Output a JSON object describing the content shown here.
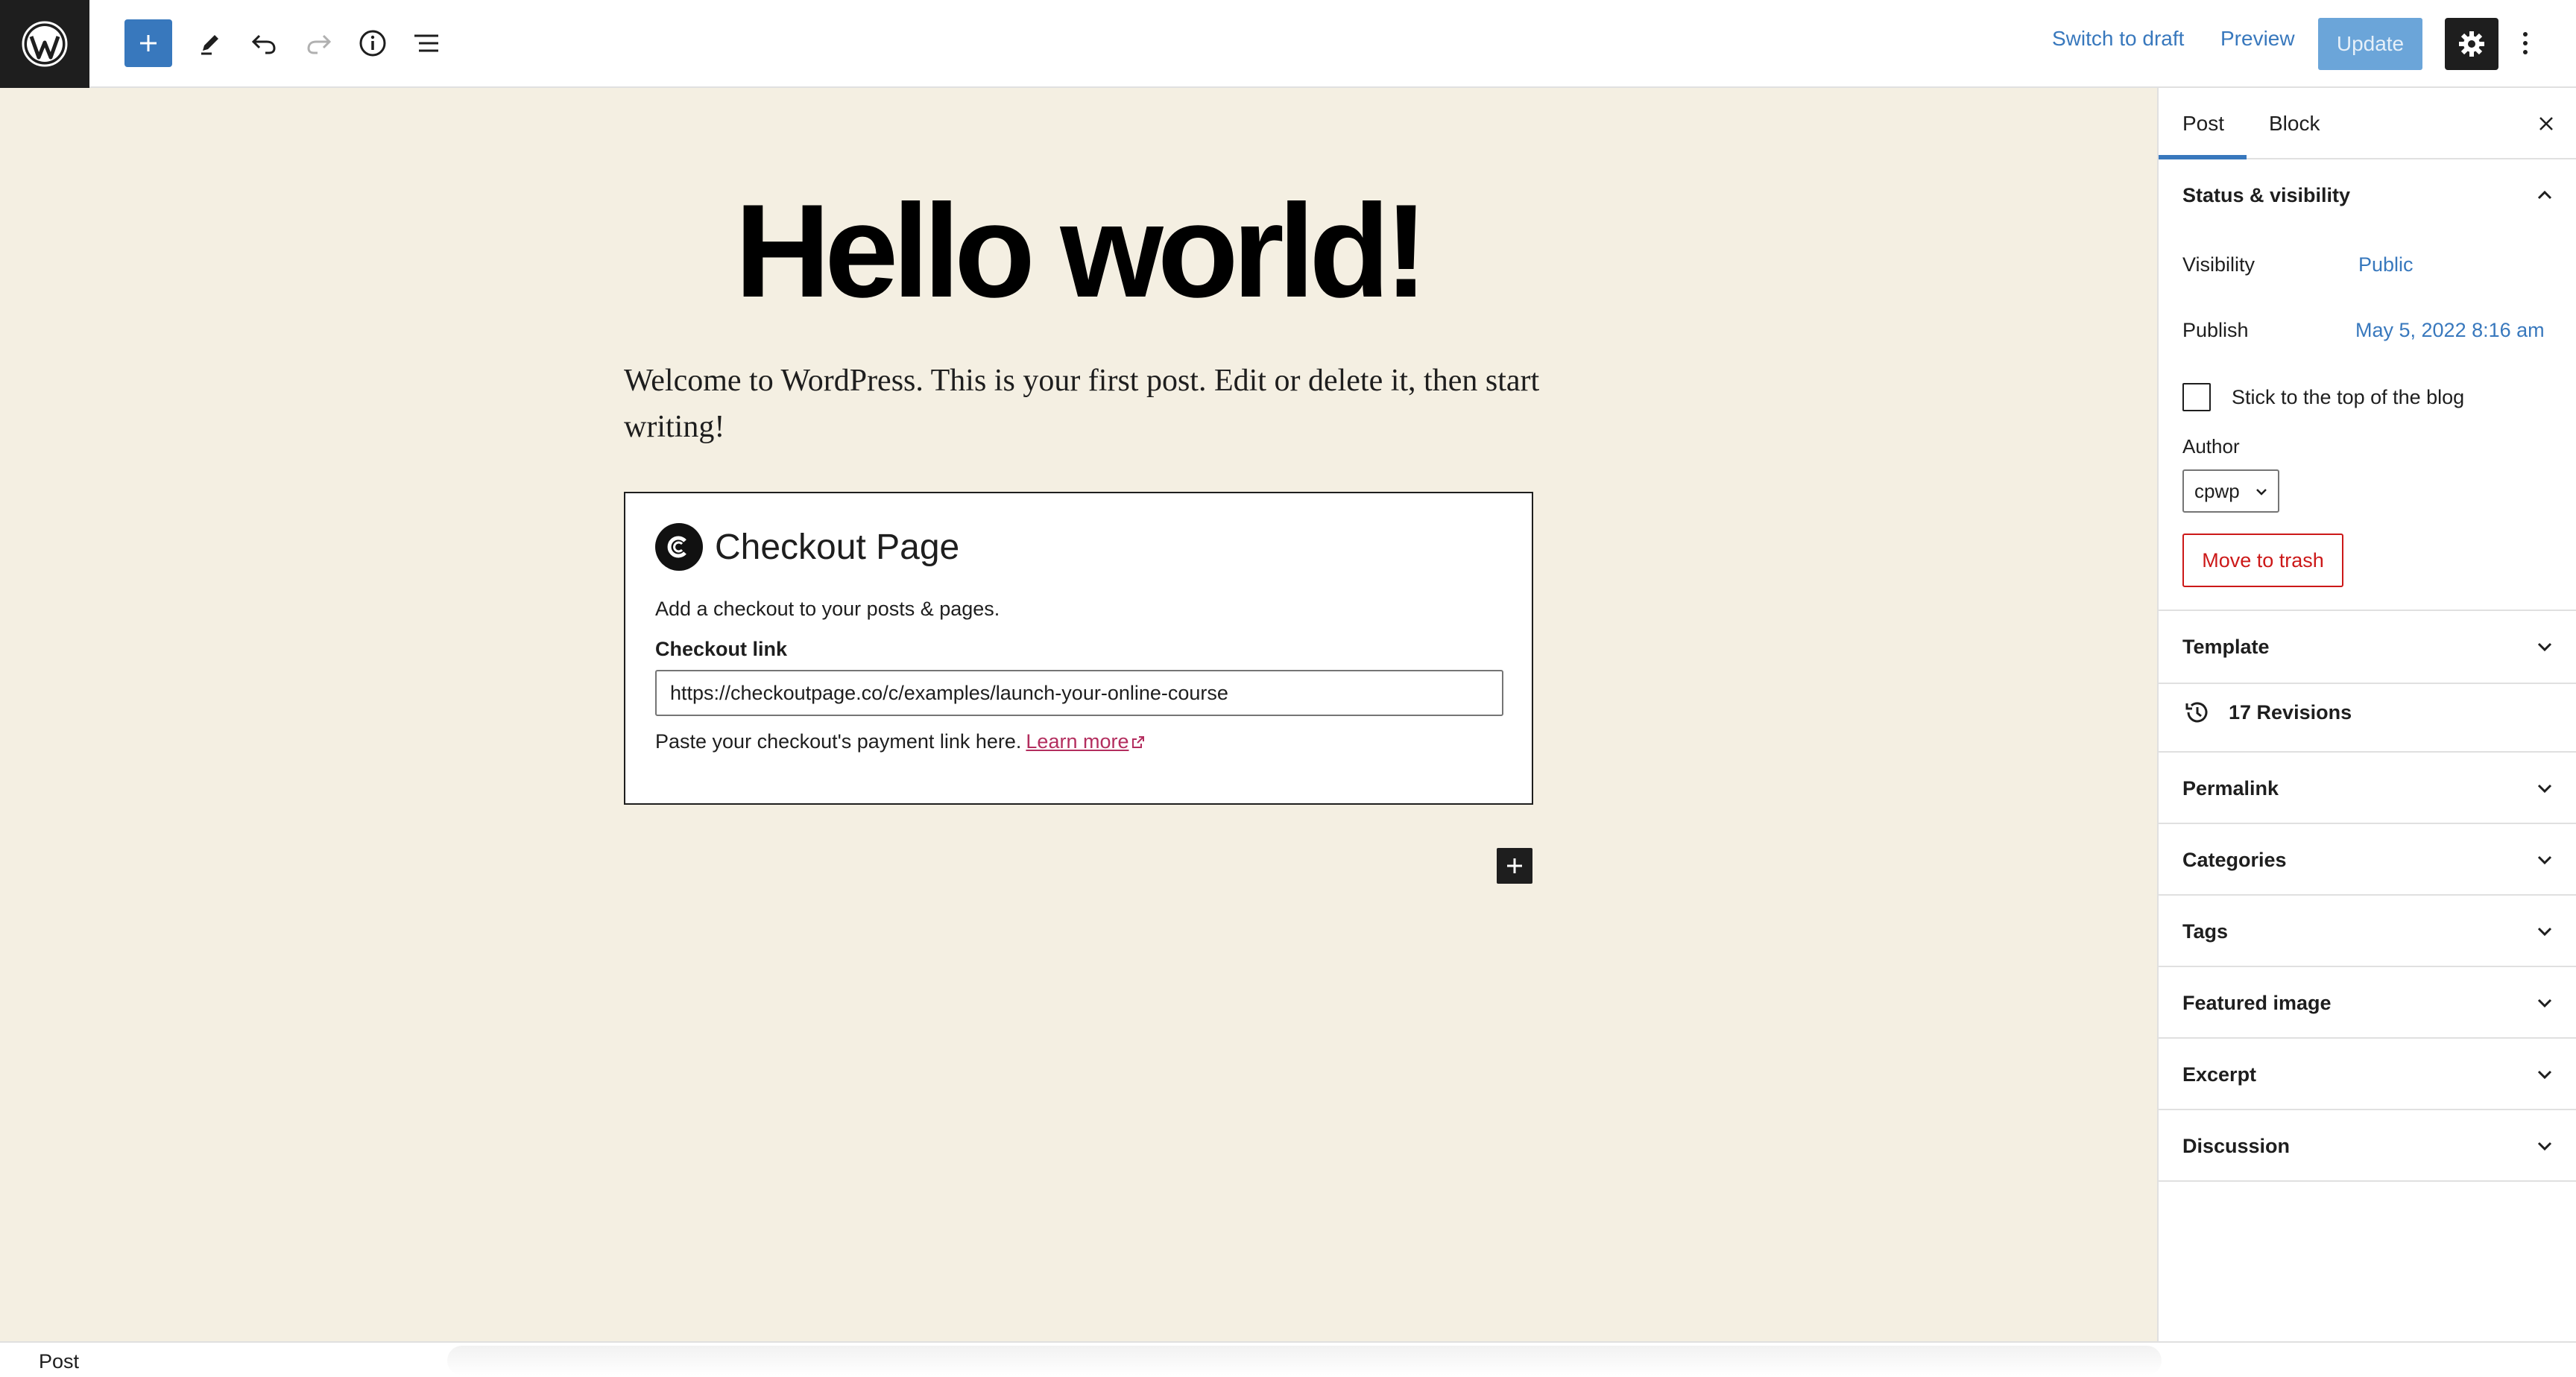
{
  "toolbar": {
    "switch_to_draft": "Switch to draft",
    "preview": "Preview",
    "update": "Update"
  },
  "post": {
    "title": "Hello world!",
    "paragraph": "Welcome to WordPress. This is your first post. Edit or delete it, then start writing!"
  },
  "checkout_block": {
    "title": "Checkout Page",
    "description": "Add a checkout to your posts & pages.",
    "link_label": "Checkout link",
    "link_value": "https://checkoutpage.co/c/examples/launch-your-online-course",
    "help_text": "Paste your checkout's payment link here.",
    "learn_more": "Learn more"
  },
  "footer": {
    "breadcrumb": "Post"
  },
  "sidebar": {
    "tabs": [
      "Post",
      "Block"
    ],
    "status": {
      "heading": "Status & visibility",
      "visibility_label": "Visibility",
      "visibility_value": "Public",
      "publish_label": "Publish",
      "publish_value": "May 5, 2022 8:16 am",
      "sticky_label": "Stick to the top of the blog",
      "sticky_checked": false,
      "author_label": "Author",
      "author_value": "cpwp",
      "trash": "Move to trash"
    },
    "template": "Template",
    "revisions": "17 Revisions",
    "sections": [
      "Permalink",
      "Categories",
      "Tags",
      "Featured image",
      "Excerpt",
      "Discussion"
    ]
  },
  "colors": {
    "accent": "#3878bd",
    "canvas_bg": "#f4efe2",
    "destructive": "#cc1818",
    "link_pink": "#b32d5e"
  }
}
